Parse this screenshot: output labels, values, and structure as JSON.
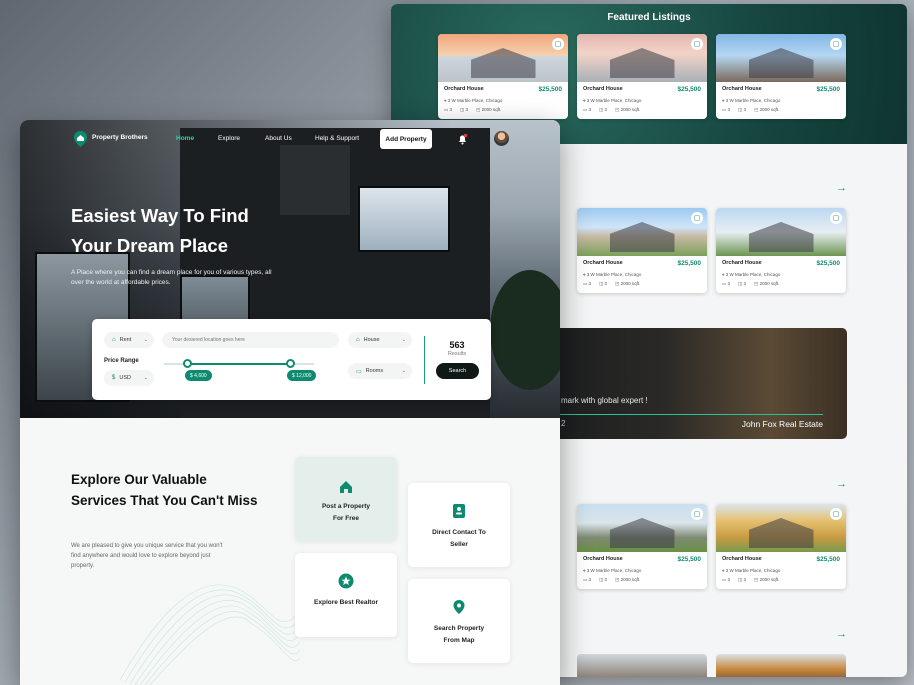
{
  "back": {
    "featured_title": "Featured Listings",
    "agent_text": "mark with global expert !",
    "agent_num": "2",
    "agent_name": "John Fox Real Estate"
  },
  "listings": [
    {
      "name": "Orchard House",
      "price": "$25,500",
      "addr": "3 W Marble Place, Chicago",
      "beds": "3",
      "baths": "3",
      "area": "2000 sqft."
    },
    {
      "name": "Orchard House",
      "price": "$25,500",
      "addr": "3 W Marble Place, Chicago",
      "beds": "3",
      "baths": "3",
      "area": "2000 sqft."
    },
    {
      "name": "Orchard House",
      "price": "$25,500",
      "addr": "3 W Marble Place, Chicago",
      "beds": "3",
      "baths": "3",
      "area": "2000 sqft."
    },
    {
      "name": "Orchard House",
      "price": "$25,500",
      "addr": "3 W Marble Place, Chicago",
      "beds": "3",
      "baths": "3",
      "area": "2000 sqft."
    },
    {
      "name": "Orchard House",
      "price": "$25,500",
      "addr": "3 W Marble Place, Chicago",
      "beds": "3",
      "baths": "3",
      "area": "2000 sqft."
    },
    {
      "name": "Orchard House",
      "price": "$25,500",
      "addr": "3 W Marble Place, Chicago",
      "beds": "3",
      "baths": "3",
      "area": "2000 sqft."
    },
    {
      "name": "Orchard House",
      "price": "$25,500",
      "addr": "3 W Marble Place, Chicago",
      "beds": "3",
      "baths": "3",
      "area": "2000 sqft."
    }
  ],
  "nav": {
    "logo": "Property Brothers",
    "home": "Home",
    "explore": "Explore",
    "about": "About Us",
    "help": "Help & Support",
    "add_property": "Add Property"
  },
  "hero": {
    "title_line1": "Easiest Way To Find",
    "title_line2": "Your Dream Place",
    "subtitle": "A Place where you can find a dream place for you of various types, all over the world at affordable prices."
  },
  "search": {
    "type": "Rent",
    "location_placeholder": "Your desiered location goes here",
    "property": "House",
    "price_range_label": "Price Range",
    "currency": "USD",
    "min_price": "$ 4,600",
    "max_price": "$ 12,000",
    "rooms": "Rooms",
    "results_count": "563",
    "results_label": "Results",
    "search_button": "Search",
    "slider_min_fraction": 0.15,
    "slider_max_fraction": 0.84
  },
  "services": {
    "title": "Explore Our Valuable Services That You Can't Miss",
    "desc": "We are pleased to give you unique service that you won't find anywhere and would love to explore beyond just property.",
    "post": "Post a Property For Free",
    "direct": "Direct Contact To Seller",
    "realtor": "Explore Best Realtor",
    "map": "Search Property From Map"
  },
  "colors": {
    "accent": "#0e8a6f",
    "dark": "#0f1a18"
  }
}
